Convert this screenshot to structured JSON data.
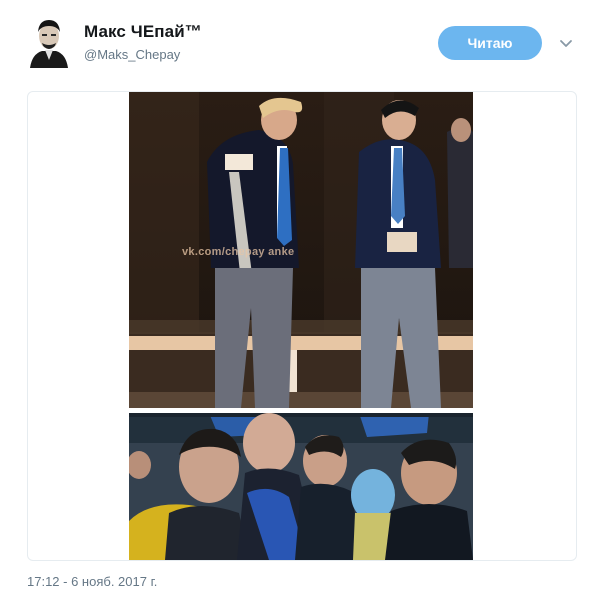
{
  "tweet": {
    "display_name": "Макс ЧЕпай™",
    "handle": "@Maks_Chepay",
    "follow_label": "Читаю",
    "timestamp": "17:12 - 6 нояб. 2017 г.",
    "avatar_icon": "avatar-portrait-icon",
    "menu_icon": "chevron-down-icon",
    "accent_color": "#6cb6ef"
  },
  "media": {
    "watermark": "vk.com/chepay anke"
  }
}
